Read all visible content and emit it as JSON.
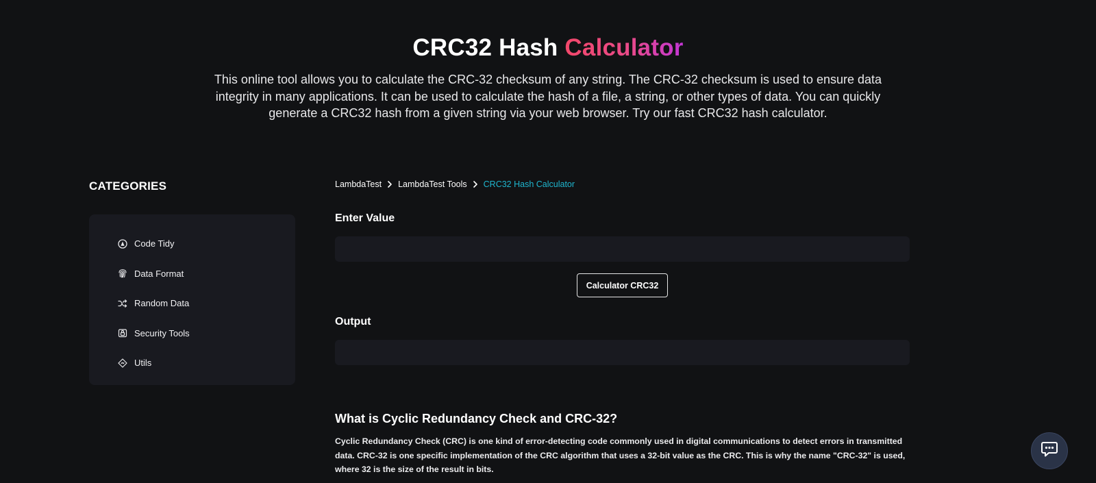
{
  "hero": {
    "title_main": "CRC32 Hash",
    "title_accent": "Calculator",
    "description": "This online tool allows you to calculate the CRC-32 checksum of any string. The CRC-32 checksum is used to ensure data integrity in many applications. It can be used to calculate the hash of a file, a string, or other types of data. You can quickly generate a CRC32 hash from a given string via your web browser. Try our fast CRC32 hash calculator."
  },
  "sidebar": {
    "heading": "CATEGORIES",
    "items": [
      {
        "label": "Code Tidy",
        "icon": "code-tidy-icon"
      },
      {
        "label": "Data Format",
        "icon": "fingerprint-icon"
      },
      {
        "label": "Random Data",
        "icon": "shuffle-icon"
      },
      {
        "label": "Security Tools",
        "icon": "lock-icon"
      },
      {
        "label": "Utils",
        "icon": "diamond-icon"
      }
    ]
  },
  "breadcrumb": {
    "items": [
      "LambdaTest",
      "LambdaTest Tools",
      "CRC32 Hash Calculator"
    ]
  },
  "form": {
    "input_label": "Enter Value",
    "input_value": "",
    "button_label": "Calculator CRC32",
    "output_label": "Output",
    "output_value": ""
  },
  "info": {
    "heading": "What is Cyclic Redundancy Check and CRC-32?",
    "text": "Cyclic Redundancy Check (CRC) is one kind of error-detecting code commonly used in digital communications to detect errors in transmitted data. CRC-32 is one specific implementation of the CRC algorithm that uses a 32-bit value as the CRC. This is why the name \"CRC-32\" is used, where 32 is the size of the result in bits."
  },
  "colors": {
    "background": "#111214",
    "panel": "#191a20",
    "breadcrumb_active": "#1fb6cf",
    "accent_gradient_start": "#f2486a",
    "accent_gradient_end": "#c236d6"
  },
  "chat": {
    "icon": "chat-icon"
  }
}
